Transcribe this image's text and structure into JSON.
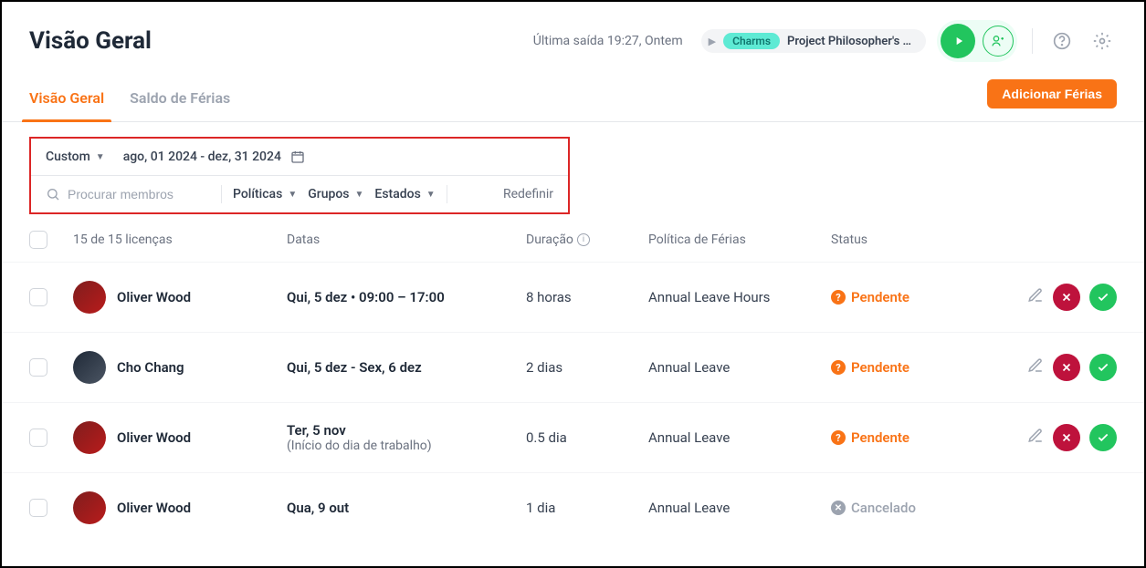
{
  "header": {
    "title": "Visão Geral",
    "last_exit": "Última saída 19:27, Ontem",
    "charm_label": "Charms",
    "project_name": "Project Philosopher's St..."
  },
  "tabs": {
    "overview": "Visão Geral",
    "balance": "Saldo de Férias"
  },
  "add_button": "Adicionar Férias",
  "filters": {
    "period_label": "Custom",
    "date_range": "ago, 01 2024 - dez, 31 2024",
    "search_placeholder": "Procurar membros",
    "policies": "Políticas",
    "groups": "Grupos",
    "states": "Estados",
    "reset": "Redefinir"
  },
  "table": {
    "count_label": "15 de 15 licenças",
    "h_dates": "Datas",
    "h_duration": "Duração",
    "h_policy": "Política de Férias",
    "h_status": "Status"
  },
  "rows": [
    {
      "name": "Oliver Wood",
      "avatar": "red",
      "dates": "Qui, 5 dez • 09:00 – 17:00",
      "sub": "",
      "duration": "8 horas",
      "policy": "Annual Leave Hours",
      "status": "Pendente",
      "status_type": "pending",
      "actions": true
    },
    {
      "name": "Cho Chang",
      "avatar": "dark",
      "dates": "Qui, 5 dez - Sex, 6 dez",
      "sub": "",
      "duration": "2 dias",
      "policy": "Annual Leave",
      "status": "Pendente",
      "status_type": "pending",
      "actions": true
    },
    {
      "name": "Oliver Wood",
      "avatar": "red",
      "dates": "Ter, 5 nov",
      "sub": "(Início do dia de trabalho)",
      "duration": "0.5 dia",
      "policy": "Annual Leave",
      "status": "Pendente",
      "status_type": "pending",
      "actions": true
    },
    {
      "name": "Oliver Wood",
      "avatar": "red",
      "dates": "Qua, 9 out",
      "sub": "",
      "duration": "1 dia",
      "policy": "Annual Leave",
      "status": "Cancelado",
      "status_type": "cancelled",
      "actions": false
    }
  ]
}
